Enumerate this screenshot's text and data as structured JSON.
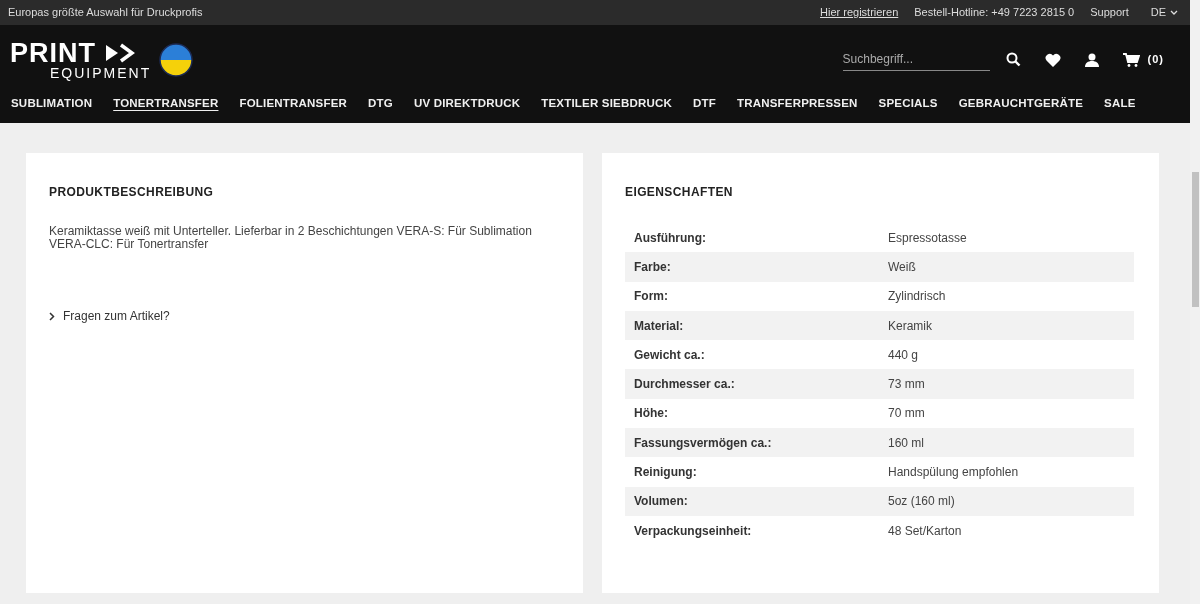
{
  "topbar": {
    "tagline": "Europas größte Auswahl für Druckprofis",
    "register_link": "Hier registrieren",
    "hotline": "Bestell-Hotline: +49 7223 2815 0",
    "support": "Support",
    "language": "DE"
  },
  "header": {
    "logo": {
      "line_1": "PRINT",
      "line_2": "EQUIPMENT"
    },
    "search": {
      "placeholder": "Suchbegriff..."
    },
    "cart_count": "(0)"
  },
  "nav": [
    {
      "label": "SUBLIMATION",
      "selected": false
    },
    {
      "label": "TONERTRANSFER",
      "selected": true
    },
    {
      "label": "FOLIENTRANSFER",
      "selected": false
    },
    {
      "label": "DTG",
      "selected": false
    },
    {
      "label": "UV DIREKTDRUCK",
      "selected": false
    },
    {
      "label": "TEXTILER SIEBDRUCK",
      "selected": false
    },
    {
      "label": "DTF",
      "selected": false
    },
    {
      "label": "TRANSFERPRESSEN",
      "selected": false
    },
    {
      "label": "SPECIALS",
      "selected": false
    },
    {
      "label": "GEBRAUCHTGERÄTE",
      "selected": false
    },
    {
      "label": "SALE",
      "selected": false
    }
  ],
  "description": {
    "title": "PRODUKTBESCHREIBUNG",
    "text": "Keramiktasse weiß mit Unterteller. Lieferbar in 2 Beschichtungen VERA-S: Für Sublimation\nVERA-CLC: Für Tonertransfer",
    "question_link": "Fragen zum Artikel?"
  },
  "properties": {
    "title": "EIGENSCHAFTEN",
    "rows": [
      {
        "label": "Ausführung:",
        "value": "Espressotasse"
      },
      {
        "label": "Farbe:",
        "value": "Weiß"
      },
      {
        "label": "Form:",
        "value": "Zylindrisch"
      },
      {
        "label": "Material:",
        "value": "Keramik"
      },
      {
        "label": "Gewicht ca.:",
        "value": "440 g"
      },
      {
        "label": "Durchmesser ca.:",
        "value": "73 mm"
      },
      {
        "label": "Höhe:",
        "value": "70 mm"
      },
      {
        "label": "Fassungsvermögen ca.:",
        "value": "160 ml"
      },
      {
        "label": "Reinigung:",
        "value": "Handspülung empfohlen"
      },
      {
        "label": "Volumen:",
        "value": "5oz (160 ml)"
      },
      {
        "label": "Verpackungseinheit:",
        "value": "48 Set/Karton"
      }
    ]
  }
}
